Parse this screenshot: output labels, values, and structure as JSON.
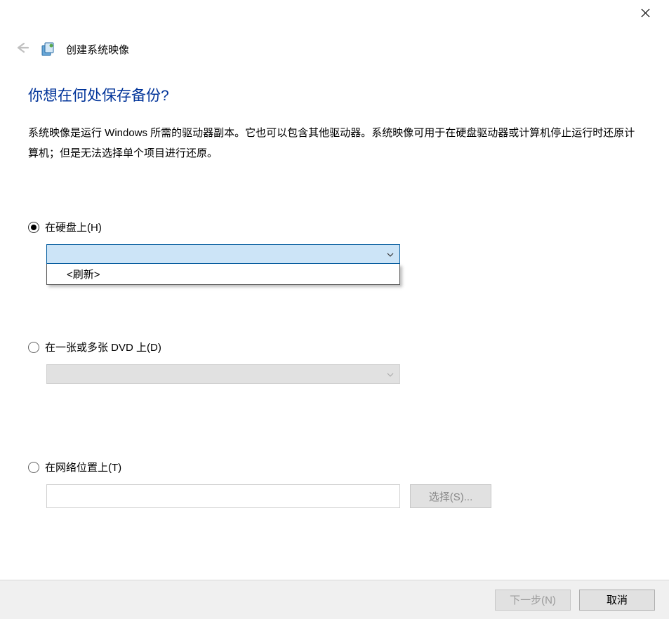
{
  "window": {
    "title": "创建系统映像"
  },
  "main": {
    "heading": "你想在何处保存备份?",
    "description": "系统映像是运行 Windows 所需的驱动器副本。它也可以包含其他驱动器。系统映像可用于在硬盘驱动器或计算机停止运行时还原计算机；但是无法选择单个项目进行还原。"
  },
  "options": {
    "harddisk": {
      "label": "在硬盘上(H)",
      "selected": true,
      "dropdown_open": true,
      "items": [
        "<刷新>"
      ]
    },
    "dvd": {
      "label": "在一张或多张 DVD 上(D)",
      "selected": false,
      "enabled": false
    },
    "network": {
      "label": "在网络位置上(T)",
      "selected": false,
      "select_button": "选择(S)...",
      "value": ""
    }
  },
  "footer": {
    "next": "下一步(N)",
    "cancel": "取消",
    "next_enabled": false
  }
}
